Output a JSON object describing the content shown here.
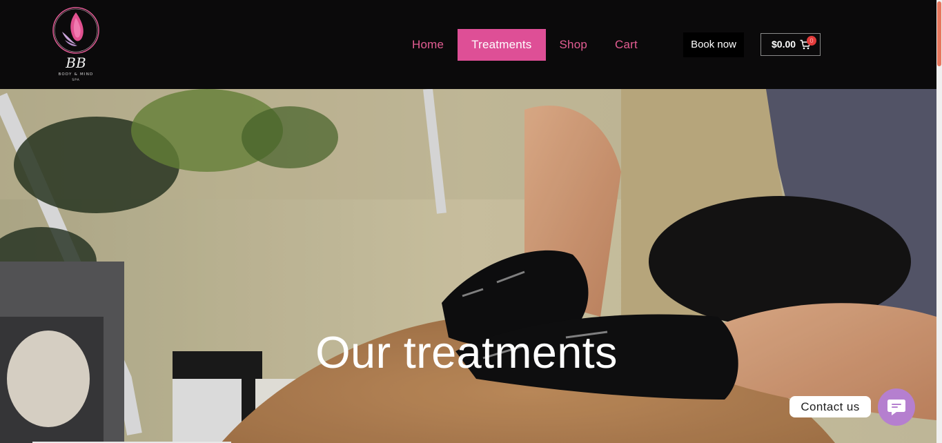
{
  "header": {
    "logo": {
      "monogram": "BB",
      "tagline": "BODY & MIND",
      "subtitle": "SPA"
    },
    "nav": [
      {
        "label": "Home",
        "active": false
      },
      {
        "label": "Treatments",
        "active": true
      },
      {
        "label": "Shop",
        "active": false
      },
      {
        "label": "Cart",
        "active": false
      }
    ],
    "book_button": "Book now",
    "cart": {
      "amount": "$0.00",
      "count": "0",
      "icon": "shopping-cart-icon"
    }
  },
  "hero": {
    "title": "Our treatments"
  },
  "contact": {
    "label": "Contact us",
    "icon": "chat-bubble-icon"
  },
  "colors": {
    "accent_pink": "#de4f96",
    "nav_text": "#e45d93",
    "header_bg": "#0b0a0b",
    "contact_purple": "#b57fcf"
  }
}
